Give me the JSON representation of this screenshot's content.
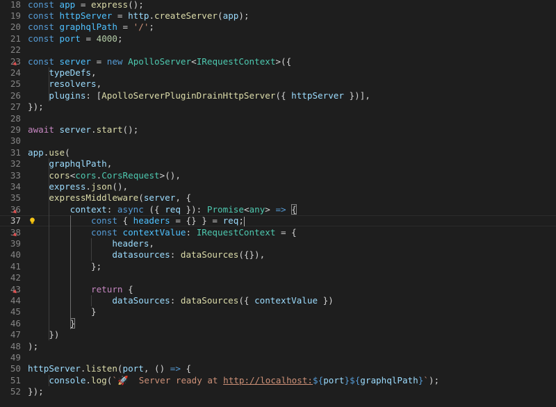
{
  "editor": {
    "language": "typescript",
    "active_line": 37,
    "lines": [
      {
        "n": "18",
        "tokens": [
          [
            "kw",
            "const"
          ],
          [
            "p",
            " "
          ],
          [
            "cst",
            "app"
          ],
          [
            "p",
            " = "
          ],
          [
            "fn",
            "express"
          ],
          [
            "p",
            "();"
          ]
        ]
      },
      {
        "n": "19",
        "tokens": [
          [
            "kw",
            "const"
          ],
          [
            "p",
            " "
          ],
          [
            "cst",
            "httpServer"
          ],
          [
            "p",
            " = "
          ],
          [
            "var",
            "http"
          ],
          [
            "p",
            "."
          ],
          [
            "fn",
            "createServer"
          ],
          [
            "p",
            "("
          ],
          [
            "var",
            "app"
          ],
          [
            "p",
            ");"
          ]
        ]
      },
      {
        "n": "20",
        "tokens": [
          [
            "kw",
            "const"
          ],
          [
            "p",
            " "
          ],
          [
            "cst",
            "graphqlPath"
          ],
          [
            "p",
            " = "
          ],
          [
            "str",
            "'/'"
          ],
          [
            "p",
            ";"
          ]
        ]
      },
      {
        "n": "21",
        "tokens": [
          [
            "kw",
            "const"
          ],
          [
            "p",
            " "
          ],
          [
            "cst",
            "port"
          ],
          [
            "p",
            " = "
          ],
          [
            "num",
            "4000"
          ],
          [
            "p",
            ";"
          ]
        ]
      },
      {
        "n": "22",
        "tokens": []
      },
      {
        "n": "23",
        "tokens": [
          [
            "kw",
            "const"
          ],
          [
            "p",
            " "
          ],
          [
            "cst",
            "server"
          ],
          [
            "p",
            " = "
          ],
          [
            "kw",
            "new"
          ],
          [
            "p",
            " "
          ],
          [
            "ty",
            "ApolloServer"
          ],
          [
            "p",
            "<"
          ],
          [
            "ty",
            "IRequestContext"
          ],
          [
            "p",
            ">({"
          ]
        ]
      },
      {
        "n": "24",
        "tokens": [
          [
            "p",
            "    "
          ],
          [
            "var",
            "typeDefs"
          ],
          [
            "p",
            ","
          ]
        ]
      },
      {
        "n": "25",
        "tokens": [
          [
            "p",
            "    "
          ],
          [
            "var",
            "resolvers"
          ],
          [
            "p",
            ","
          ]
        ]
      },
      {
        "n": "26",
        "tokens": [
          [
            "p",
            "    "
          ],
          [
            "var",
            "plugins"
          ],
          [
            "p",
            ": ["
          ],
          [
            "fn",
            "ApolloServerPluginDrainHttpServer"
          ],
          [
            "p",
            "({ "
          ],
          [
            "var",
            "httpServer"
          ],
          [
            "p",
            " })],"
          ]
        ]
      },
      {
        "n": "27",
        "tokens": [
          [
            "p",
            "});"
          ]
        ]
      },
      {
        "n": "28",
        "tokens": []
      },
      {
        "n": "29",
        "tokens": [
          [
            "ctl",
            "await"
          ],
          [
            "p",
            " "
          ],
          [
            "var",
            "server"
          ],
          [
            "p",
            "."
          ],
          [
            "fn",
            "start"
          ],
          [
            "p",
            "();"
          ]
        ]
      },
      {
        "n": "30",
        "tokens": []
      },
      {
        "n": "31",
        "tokens": [
          [
            "var",
            "app"
          ],
          [
            "p",
            "."
          ],
          [
            "fn",
            "use"
          ],
          [
            "p",
            "("
          ]
        ]
      },
      {
        "n": "32",
        "tokens": [
          [
            "p",
            "    "
          ],
          [
            "var",
            "graphqlPath"
          ],
          [
            "p",
            ","
          ]
        ]
      },
      {
        "n": "33",
        "tokens": [
          [
            "p",
            "    "
          ],
          [
            "fn",
            "cors"
          ],
          [
            "p",
            "<"
          ],
          [
            "ty",
            "cors"
          ],
          [
            "p",
            "."
          ],
          [
            "ty",
            "CorsRequest"
          ],
          [
            "p",
            ">(),"
          ]
        ]
      },
      {
        "n": "34",
        "tokens": [
          [
            "p",
            "    "
          ],
          [
            "var",
            "express"
          ],
          [
            "p",
            "."
          ],
          [
            "fn",
            "json"
          ],
          [
            "p",
            "(),"
          ]
        ]
      },
      {
        "n": "35",
        "tokens": [
          [
            "p",
            "    "
          ],
          [
            "fn",
            "expressMiddleware"
          ],
          [
            "p",
            "("
          ],
          [
            "var",
            "server"
          ],
          [
            "p",
            ", {"
          ]
        ]
      },
      {
        "n": "36",
        "tokens": [
          [
            "p",
            "        "
          ],
          [
            "var",
            "context"
          ],
          [
            "p",
            ": "
          ],
          [
            "kw",
            "async"
          ],
          [
            "p",
            " ({ "
          ],
          [
            "var",
            "req"
          ],
          [
            "p",
            " }): "
          ],
          [
            "ty",
            "Promise"
          ],
          [
            "p",
            "<"
          ],
          [
            "ty",
            "any"
          ],
          [
            "p",
            "> "
          ],
          [
            "kw",
            "=>"
          ],
          [
            "p",
            " "
          ],
          [
            "box",
            "{"
          ]
        ]
      },
      {
        "n": "37",
        "tokens": [
          [
            "p",
            "            "
          ],
          [
            "kw",
            "const"
          ],
          [
            "p",
            " { "
          ],
          [
            "cst",
            "headers"
          ],
          [
            "p",
            " = {} } = "
          ],
          [
            "var",
            "req"
          ],
          [
            "p",
            ";"
          ],
          [
            "cursor",
            ""
          ]
        ]
      },
      {
        "n": "38",
        "tokens": [
          [
            "p",
            "            "
          ],
          [
            "kw",
            "const"
          ],
          [
            "p",
            " "
          ],
          [
            "cst",
            "contextValue"
          ],
          [
            "p",
            ": "
          ],
          [
            "ty",
            "IRequestContext"
          ],
          [
            "p",
            " = {"
          ]
        ]
      },
      {
        "n": "39",
        "tokens": [
          [
            "p",
            "                "
          ],
          [
            "var",
            "headers"
          ],
          [
            "p",
            ","
          ]
        ]
      },
      {
        "n": "40",
        "tokens": [
          [
            "p",
            "                "
          ],
          [
            "var",
            "datasources"
          ],
          [
            "p",
            ": "
          ],
          [
            "fn",
            "dataSources"
          ],
          [
            "p",
            "({}),"
          ]
        ]
      },
      {
        "n": "41",
        "tokens": [
          [
            "p",
            "            };"
          ]
        ]
      },
      {
        "n": "42",
        "tokens": []
      },
      {
        "n": "43",
        "tokens": [
          [
            "p",
            "            "
          ],
          [
            "ctl",
            "return"
          ],
          [
            "p",
            " {"
          ]
        ]
      },
      {
        "n": "44",
        "tokens": [
          [
            "p",
            "                "
          ],
          [
            "var",
            "dataSources"
          ],
          [
            "p",
            ": "
          ],
          [
            "fn",
            "dataSources"
          ],
          [
            "p",
            "({ "
          ],
          [
            "var",
            "contextValue"
          ],
          [
            "p",
            " })"
          ]
        ]
      },
      {
        "n": "45",
        "tokens": [
          [
            "p",
            "            }"
          ]
        ]
      },
      {
        "n": "46",
        "tokens": [
          [
            "p",
            "        "
          ],
          [
            "box",
            "}"
          ]
        ]
      },
      {
        "n": "47",
        "tokens": [
          [
            "p",
            "    })"
          ]
        ]
      },
      {
        "n": "48",
        "tokens": [
          [
            "p",
            ");"
          ]
        ]
      },
      {
        "n": "49",
        "tokens": []
      },
      {
        "n": "50",
        "tokens": [
          [
            "var",
            "httpServer"
          ],
          [
            "p",
            "."
          ],
          [
            "fn",
            "listen"
          ],
          [
            "p",
            "("
          ],
          [
            "var",
            "port"
          ],
          [
            "p",
            ", () "
          ],
          [
            "kw",
            "=>"
          ],
          [
            "p",
            " {"
          ]
        ]
      },
      {
        "n": "51",
        "tokens": [
          [
            "p",
            "    "
          ],
          [
            "var",
            "console"
          ],
          [
            "p",
            "."
          ],
          [
            "fn",
            "log"
          ],
          [
            "p",
            "("
          ],
          [
            "str",
            "`🚀  Server ready at "
          ],
          [
            "url",
            "http://localhost:"
          ],
          [
            "kw",
            "${"
          ],
          [
            "tplv",
            "port"
          ],
          [
            "kw",
            "}${"
          ],
          [
            "tplv",
            "graphqlPath"
          ],
          [
            "kw",
            "}"
          ],
          [
            "str",
            "`"
          ],
          [
            "p",
            ");"
          ]
        ]
      },
      {
        "n": "52",
        "tokens": [
          [
            "p",
            "});"
          ]
        ]
      }
    ],
    "fold_marker_lines": [
      23,
      36,
      38,
      43
    ],
    "lightbulb_line": 37,
    "colors": {
      "background": "#1e1e1e",
      "keyword": "#569cd6",
      "control": "#c586c0",
      "variable": "#9cdcfe",
      "constant": "#4fc1ff",
      "function": "#dcdcaa",
      "type": "#4ec9b0",
      "string": "#ce9178",
      "number": "#b5cea8"
    }
  }
}
